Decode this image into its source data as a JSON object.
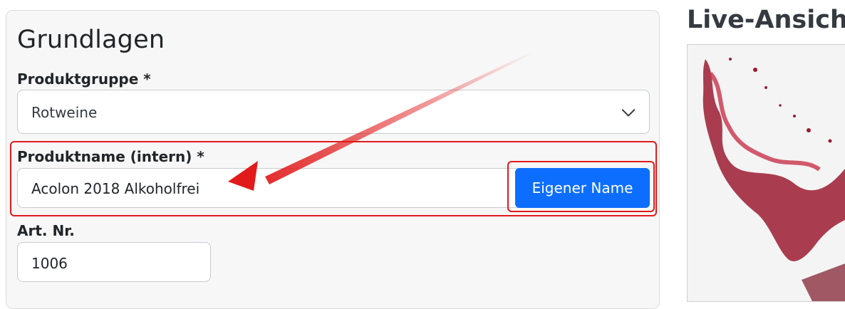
{
  "basics": {
    "title": "Grundlagen",
    "product_group": {
      "label": "Produktgruppe *",
      "value": "Rotweine"
    },
    "product_name": {
      "label": "Produktname (intern) *",
      "value": "Acolon 2018 Alkoholfrei",
      "button_label": "Eigener Name"
    },
    "article_number": {
      "label": "Art. Nr.",
      "value": "1006"
    }
  },
  "live_view": {
    "title": "Live-Ansicht",
    "image": "red-wine-splash"
  },
  "colors": {
    "accent": "#0d6efd",
    "annotation_red": "#e11b1b"
  }
}
